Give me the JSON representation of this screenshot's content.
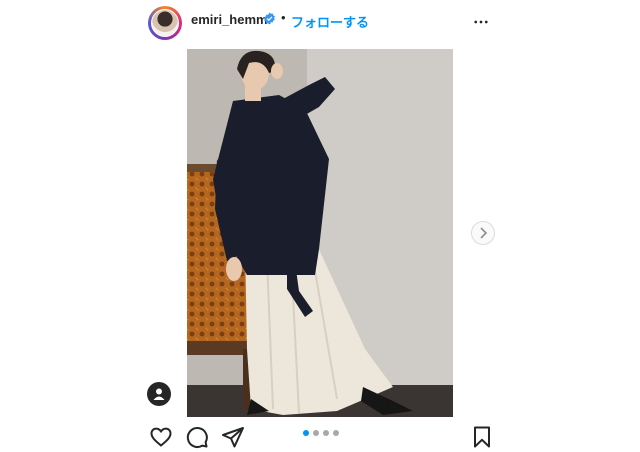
{
  "header": {
    "username": "emiri_hemmi",
    "separator": "•",
    "follow_label": "フォローする"
  },
  "icons": {
    "verified": "verified-badge-icon",
    "more": "more-options-icon",
    "next": "chevron-right-icon",
    "user_tag": "user-tag-icon",
    "like": "heart-icon",
    "comment": "comment-icon",
    "share": "paper-plane-icon",
    "save": "bookmark-icon"
  },
  "carousel": {
    "count": 4,
    "active_index": 0
  },
  "colors": {
    "accent": "#0095f6",
    "text": "#262626",
    "dot_inactive": "#a8a8a8"
  }
}
